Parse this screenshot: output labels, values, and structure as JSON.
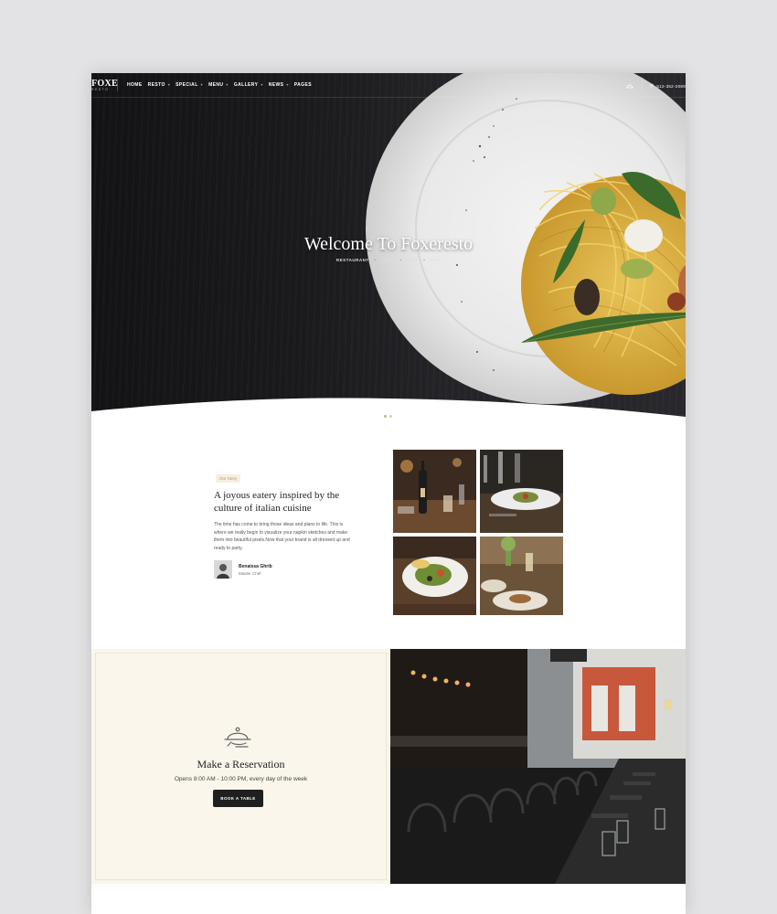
{
  "brand": {
    "logo": "FOXE",
    "logo_sub": "RESTO"
  },
  "nav": {
    "items": [
      {
        "label": "HOME"
      },
      {
        "label": "RESTO"
      },
      {
        "label": "SPECIAL"
      },
      {
        "label": "MENU"
      },
      {
        "label": "GALLERY"
      },
      {
        "label": "NEWS"
      },
      {
        "label": "PAGES"
      }
    ],
    "phone": "512-352-2089"
  },
  "hero": {
    "title": "Welcome To Foxeresto",
    "tags": [
      "RESTAURANT",
      "CAFE",
      "BAR",
      "24/7"
    ]
  },
  "story": {
    "badge": "Our Story",
    "title": "A joyous eatery inspired by the culture of italian cuisine",
    "text": "The time has come to bring those ideas and plans to life. This is where we really begin to visualize your napkin sketches and make them into beautiful pixels.Now that your brand is all dressed up and ready to party.",
    "author_name": "Benaissa Ghrib",
    "author_role": "Master Chef"
  },
  "reservation": {
    "title": "Make a Reservation",
    "hours": "Opens 8:00 AM - 10:00 PM, every day of the week",
    "button": "BOOK A TABLE"
  },
  "colors": {
    "accent": "#c8b48a",
    "reservation_bg": "#faf6ec",
    "button_bg": "#1f1f1f",
    "hero_bg": "#1b1b1e"
  }
}
